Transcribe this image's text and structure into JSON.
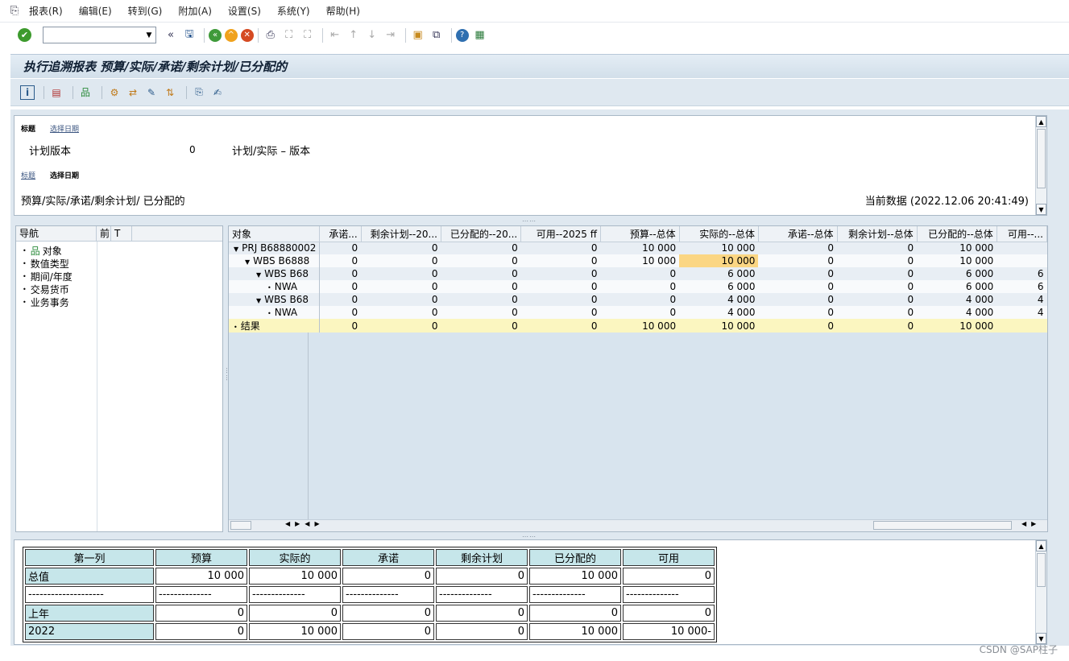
{
  "menu": [
    "报表(R)",
    "编辑(E)",
    "转到(G)",
    "附加(A)",
    "设置(S)",
    "系统(Y)",
    "帮助(H)"
  ],
  "title": "执行追溯报表 预算/实际/承诺/剩余计划/已分配的",
  "header": {
    "tab_label": "标题",
    "tab_link": "选择日期",
    "plan_version_label": "计划版本",
    "plan_version_value": "0",
    "plan_version_desc": "计划/实际 – 版本",
    "tab2_link": "标题",
    "tab2_label": "选择日期",
    "report_subtitle": "预算/实际/承诺/剩余计划/ 已分配的",
    "current_data": "当前数据 (2022.12.06 20:41:49)"
  },
  "nav": {
    "columns": [
      "导航",
      "前",
      "T"
    ],
    "items": [
      "对象",
      "数值类型",
      "期间/年度",
      "交易货币",
      "业务事务"
    ]
  },
  "grid": {
    "columns": [
      "对象",
      "承诺...",
      "剩余计划--20...",
      "已分配的--20...",
      "可用--2025 ff",
      "预算--总体",
      "实际的--总体",
      "承诺--总体",
      "剩余计划--总体",
      "已分配的--总体",
      "可用--..."
    ],
    "rows": [
      {
        "obj": "PRJ B68880002",
        "indent": 0,
        "toggle": "down",
        "vals": [
          "0",
          "0",
          "0",
          "0",
          "10 000",
          "10 000",
          "0",
          "0",
          "10 000",
          ""
        ],
        "style": "even"
      },
      {
        "obj": "WBS B6888",
        "indent": 1,
        "toggle": "down",
        "vals": [
          "0",
          "0",
          "0",
          "0",
          "10 000",
          "10 000",
          "0",
          "0",
          "10 000",
          ""
        ],
        "style": "odd",
        "hl": 5
      },
      {
        "obj": "WBS B68",
        "indent": 2,
        "toggle": "down",
        "vals": [
          "0",
          "0",
          "0",
          "0",
          "0",
          "6 000",
          "0",
          "0",
          "6 000",
          "6"
        ],
        "style": "even"
      },
      {
        "obj": "NWA",
        "indent": 3,
        "toggle": "leaf",
        "vals": [
          "0",
          "0",
          "0",
          "0",
          "0",
          "6 000",
          "0",
          "0",
          "6 000",
          "6"
        ],
        "style": "odd"
      },
      {
        "obj": "WBS B68",
        "indent": 2,
        "toggle": "down",
        "vals": [
          "0",
          "0",
          "0",
          "0",
          "0",
          "4 000",
          "0",
          "0",
          "4 000",
          "4"
        ],
        "style": "even"
      },
      {
        "obj": "NWA",
        "indent": 3,
        "toggle": "leaf",
        "vals": [
          "0",
          "0",
          "0",
          "0",
          "0",
          "4 000",
          "0",
          "0",
          "4 000",
          "4"
        ],
        "style": "odd"
      },
      {
        "obj": "结果",
        "indent": 0,
        "toggle": "dot",
        "vals": [
          "0",
          "0",
          "0",
          "0",
          "10 000",
          "10 000",
          "0",
          "0",
          "10 000",
          ""
        ],
        "style": "res"
      }
    ]
  },
  "summary": {
    "columns": [
      "第一列",
      "预算",
      "实际的",
      "承诺",
      "剩余计划",
      "已分配的",
      "可用"
    ],
    "rows": [
      [
        "总值",
        "10 000",
        "10 000",
        "0",
        "0",
        "10 000",
        "0"
      ],
      [
        "--------------------",
        "--------------",
        "--------------",
        "--------------",
        "--------------",
        "--------------",
        "--------------"
      ],
      [
        "上年",
        "0",
        "0",
        "0",
        "0",
        "0",
        "0"
      ],
      [
        "2022",
        "0",
        "10 000",
        "0",
        "0",
        "10 000",
        "10 000-"
      ]
    ]
  },
  "watermark": "CSDN @SAP柱子"
}
